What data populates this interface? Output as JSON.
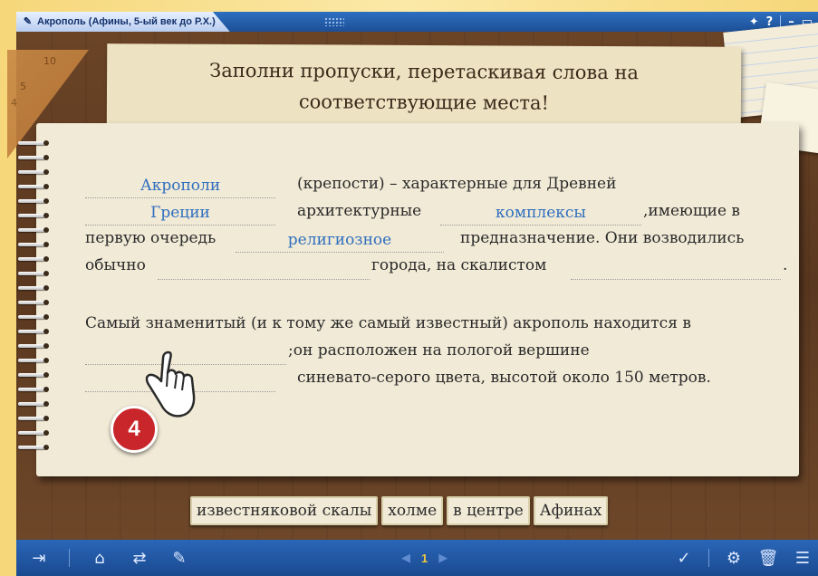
{
  "window": {
    "title": "Акрополь (Афины, 5-ый век до Р.Х.)",
    "icons": [
      "edit-window-icon",
      "pin-icon",
      "help-icon",
      "minimize-icon",
      "restore-icon"
    ],
    "help_label": "?"
  },
  "ruler": {
    "marks": [
      "10",
      "5",
      "4"
    ]
  },
  "instruction": {
    "line1": "Заполни пропуски, перетаскивая слова на",
    "line2": "соответствующие места!"
  },
  "exercise": {
    "p1": {
      "slot1": "Акрополи",
      "t1": "(крепости) – характерные для Древней",
      "slot2": "Греции",
      "t2": "архитектурные",
      "slot3": "комплексы",
      "t3": ",имеющие в",
      "t4": "первую очередь",
      "slot4": "религиозное",
      "t5": "предназначение. Они возводились",
      "t6": "обычно",
      "slot5": "",
      "t7": "города, на скалистом",
      "slot6": "",
      "t8": "."
    },
    "p2": {
      "t1": "Самый знаменитый (и к тому же самый известный) акрополь находится в",
      "slot1": "",
      "t2": ";он расположен на пологой вершине",
      "slot2": "",
      "t3": "синевато-серого цвета, высотой около 150 метров."
    }
  },
  "step_badge": "4",
  "word_bank": [
    "известняковой скалы",
    "холме",
    "в центре",
    "Афинах"
  ],
  "toolbar": {
    "left_icons": [
      "exit-icon",
      "home-icon",
      "refresh-icon",
      "notes-icon"
    ],
    "page_number": "1",
    "right_icons": [
      "check-icon",
      "settings-icon",
      "trash-icon",
      "menu-icon"
    ]
  },
  "colors": {
    "accent_blue": "#2f6fbf",
    "badge_red": "#c8262a",
    "bar_blue": "#1d4f96"
  }
}
